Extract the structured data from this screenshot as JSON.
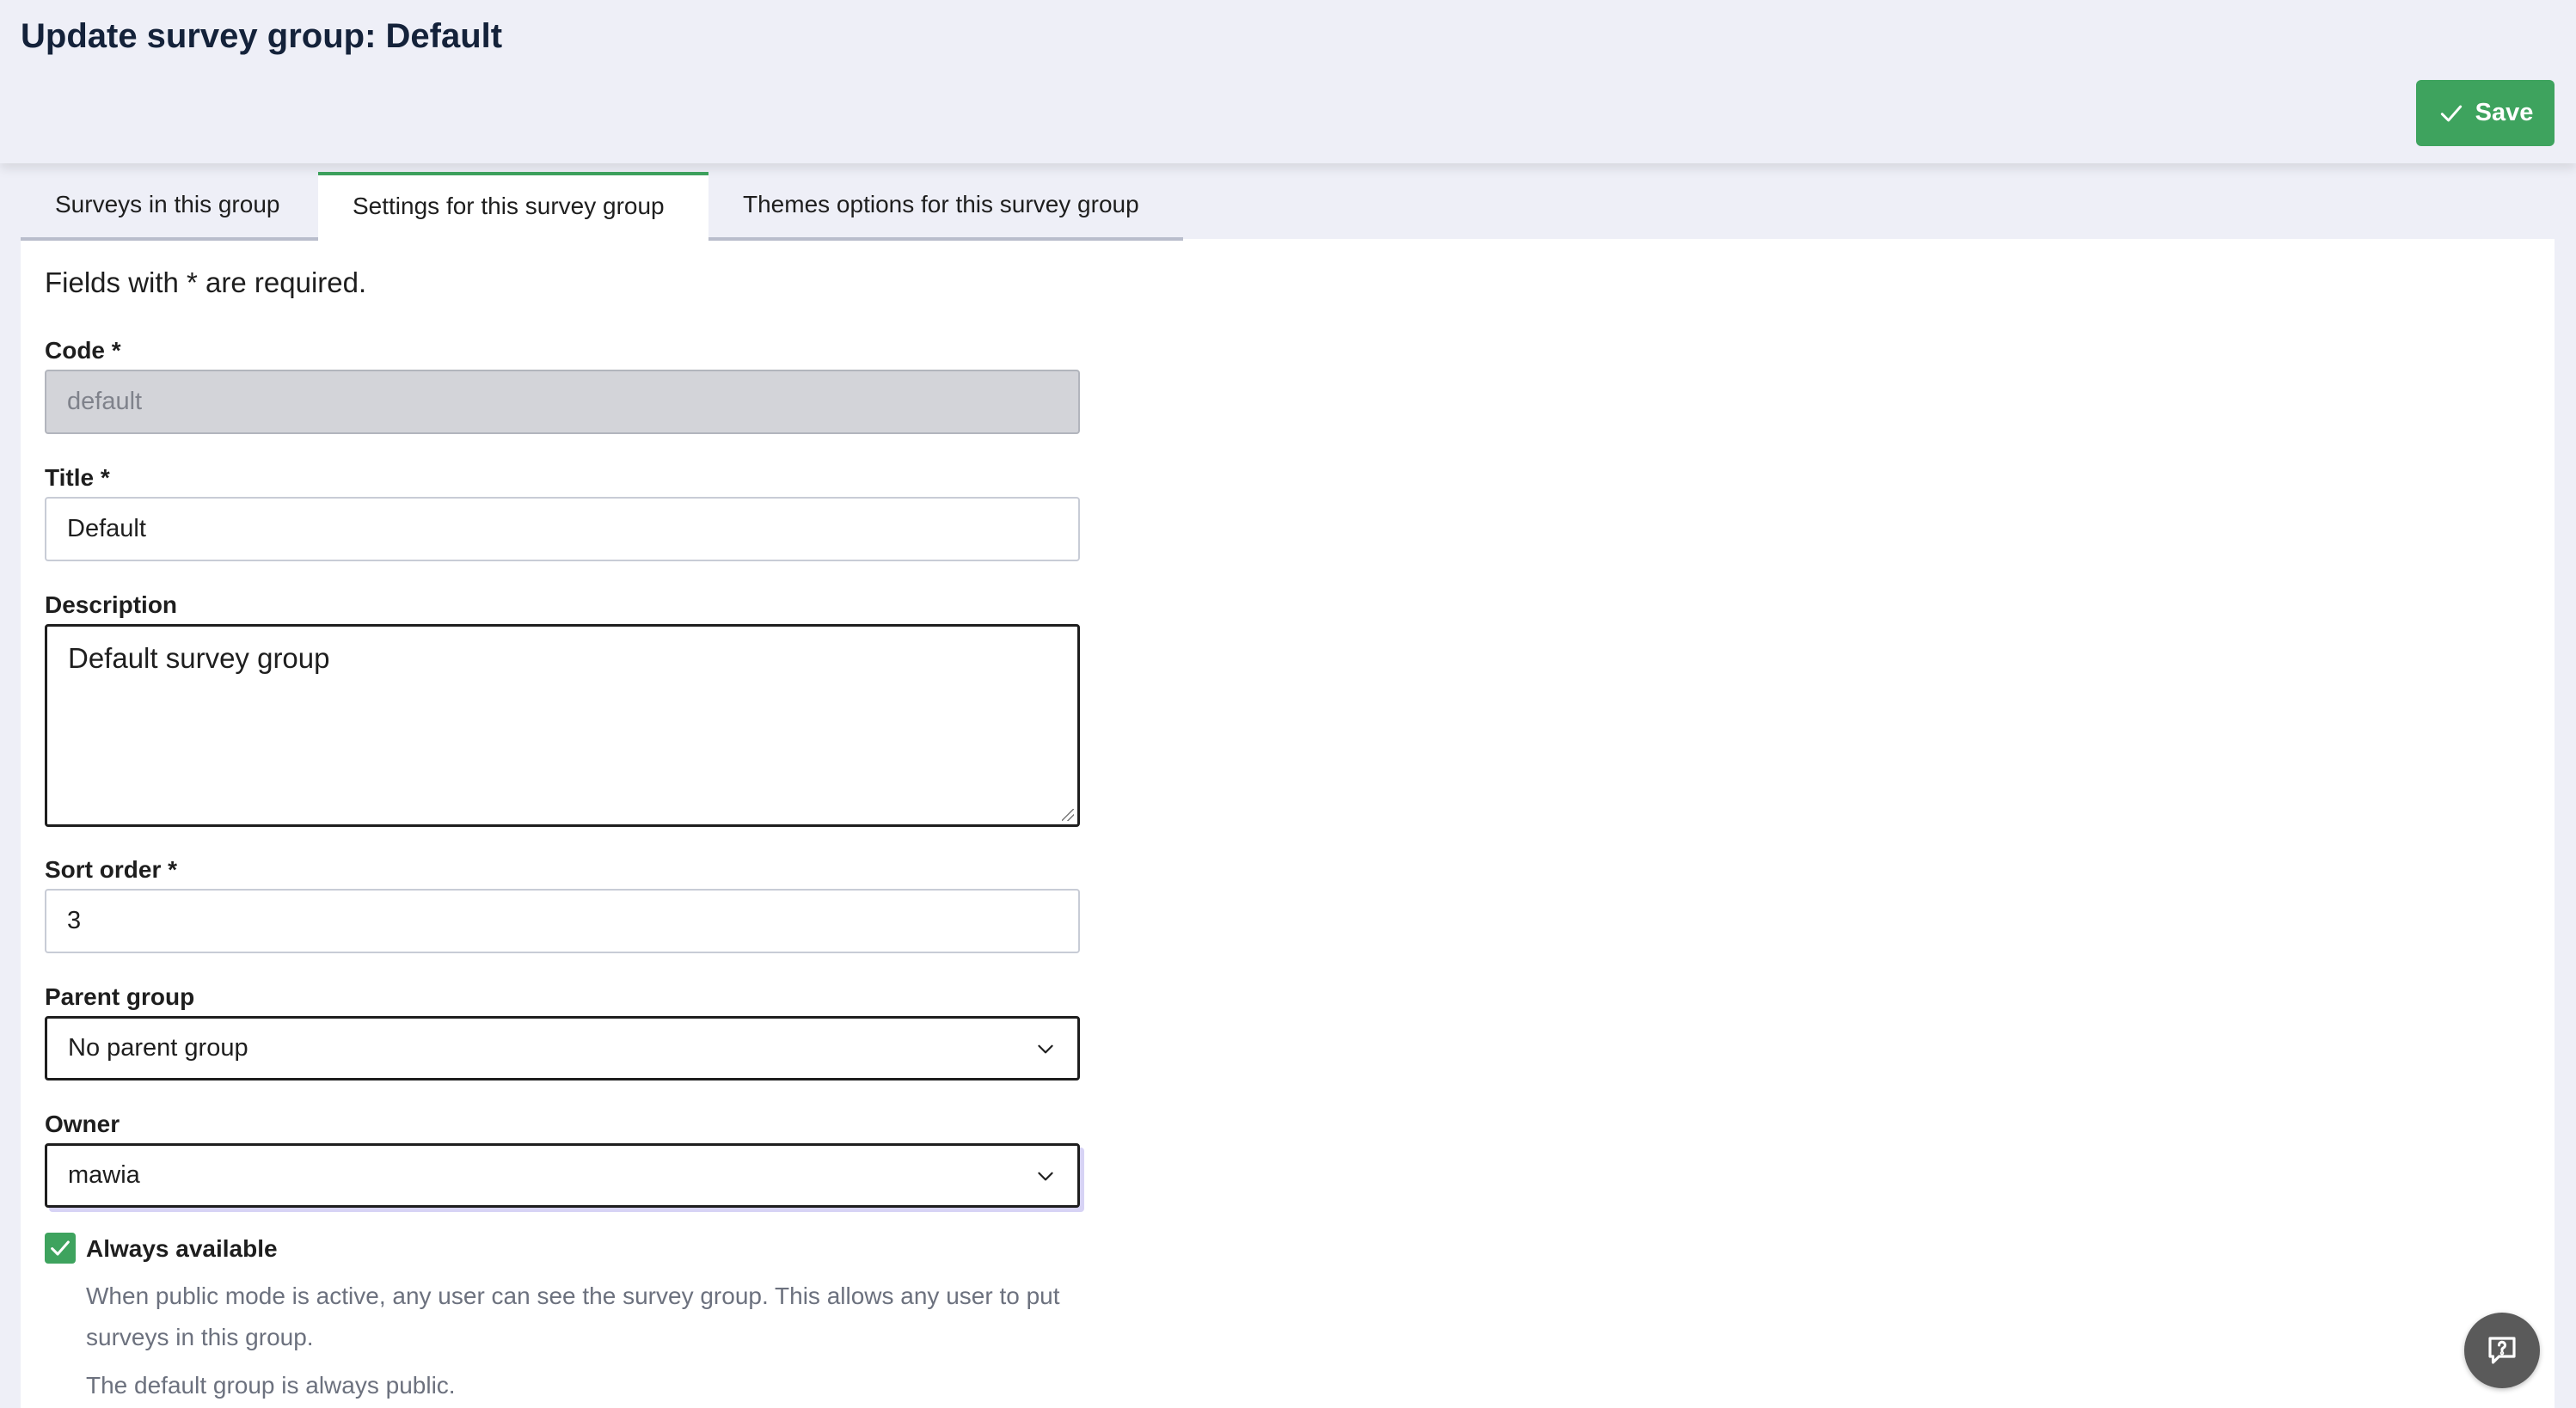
{
  "header": {
    "title": "Update survey group: Default",
    "save_label": "Save"
  },
  "tabs": [
    {
      "label": "Surveys in this group",
      "active": false
    },
    {
      "label": "Settings for this survey group",
      "active": true
    },
    {
      "label": "Themes options for this survey group",
      "active": false
    }
  ],
  "form": {
    "required_note": "Fields with * are required.",
    "code": {
      "label": "Code *",
      "value": "default",
      "disabled": true
    },
    "title": {
      "label": "Title *",
      "value": "Default"
    },
    "description": {
      "label": "Description",
      "value": "Default survey group"
    },
    "sort_order": {
      "label": "Sort order *",
      "value": "3"
    },
    "parent_group": {
      "label": "Parent group",
      "selected": "No parent group"
    },
    "owner": {
      "label": "Owner",
      "selected": "mawia"
    },
    "always_available": {
      "label": "Always available",
      "checked": true,
      "help_1": "When public mode is active, any user can see the survey group. This allows any user to put surveys in this group.",
      "help_2": "The default group is always public."
    }
  },
  "colors": {
    "accent": "#3ea35e",
    "background": "#eeeff7",
    "help_button": "#5a5a5a"
  },
  "icons": {
    "save": "check-icon",
    "select": "chevron-down-icon",
    "help": "help-chat-icon"
  }
}
